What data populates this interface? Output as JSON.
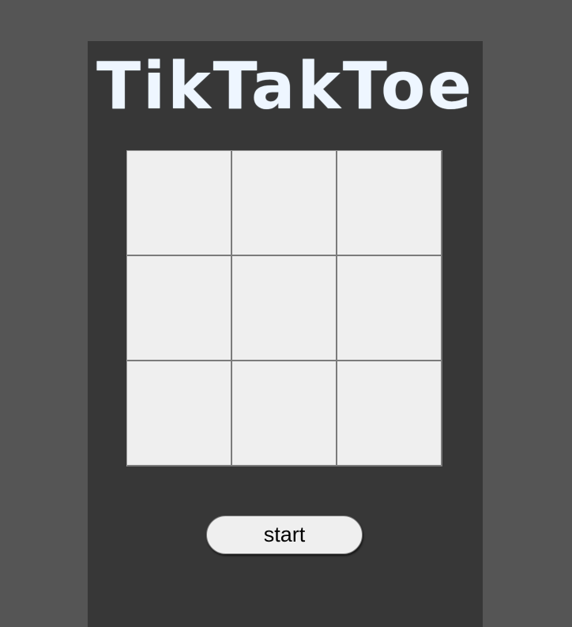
{
  "app": {
    "title": "TikTakToe"
  },
  "board": {
    "cells": [
      "",
      "",
      "",
      "",
      "",
      "",
      "",
      "",
      ""
    ]
  },
  "controls": {
    "start_label": "start"
  },
  "colors": {
    "background": "#555555",
    "panel": "#373737",
    "title": "#eef6ff",
    "cell": "#efefef",
    "grid_line": "#7b7b7b"
  }
}
